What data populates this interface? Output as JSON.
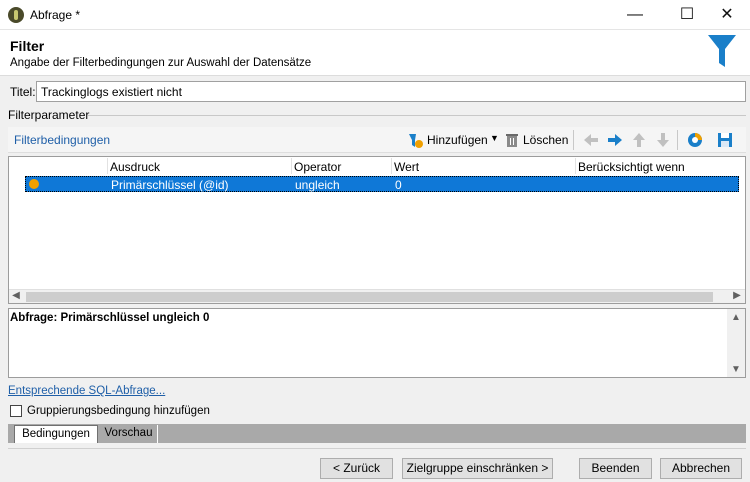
{
  "window": {
    "title": "Abfrage *",
    "minimize": "—",
    "maximize": "☐",
    "close": "✕"
  },
  "header": {
    "title": "Filter",
    "subtitle": "Angabe der Filterbedingungen zur Auswahl der Datensätze"
  },
  "form": {
    "titel_label": "Titel:",
    "titel_value": "Trackinglogs existiert nicht",
    "filterparameter_label": "Filterparameter"
  },
  "toolbar": {
    "section_label": "Filterbedingungen",
    "add_label": "Hinzufügen",
    "delete_label": "Löschen"
  },
  "table": {
    "columns": [
      "Ausdruck",
      "Operator",
      "Wert",
      "Berücksichtigt wenn"
    ],
    "rows": [
      {
        "ausdruck": "Primärschlüssel (@id)",
        "operator": "ungleich",
        "wert": "0",
        "beruecksichtigt": ""
      }
    ]
  },
  "summary": {
    "text": "Abfrage: Primärschlüssel ungleich 0"
  },
  "links": {
    "sql": "Entsprechende SQL-Abfrage..."
  },
  "group": {
    "label": "Gruppierungsbedingung hinzufügen",
    "checked": false
  },
  "tabs": [
    {
      "label": "Bedingungen",
      "active": true
    },
    {
      "label": "Vorschau",
      "active": false
    }
  ],
  "buttons": {
    "back": "< Zurück",
    "restrict": "Zielgruppe einschränken >",
    "finish": "Beenden",
    "cancel": "Abbrechen"
  },
  "colors": {
    "accent": "#1f5fa8",
    "selection": "#0f78d7",
    "filter_icon": "#1a7fc9"
  }
}
